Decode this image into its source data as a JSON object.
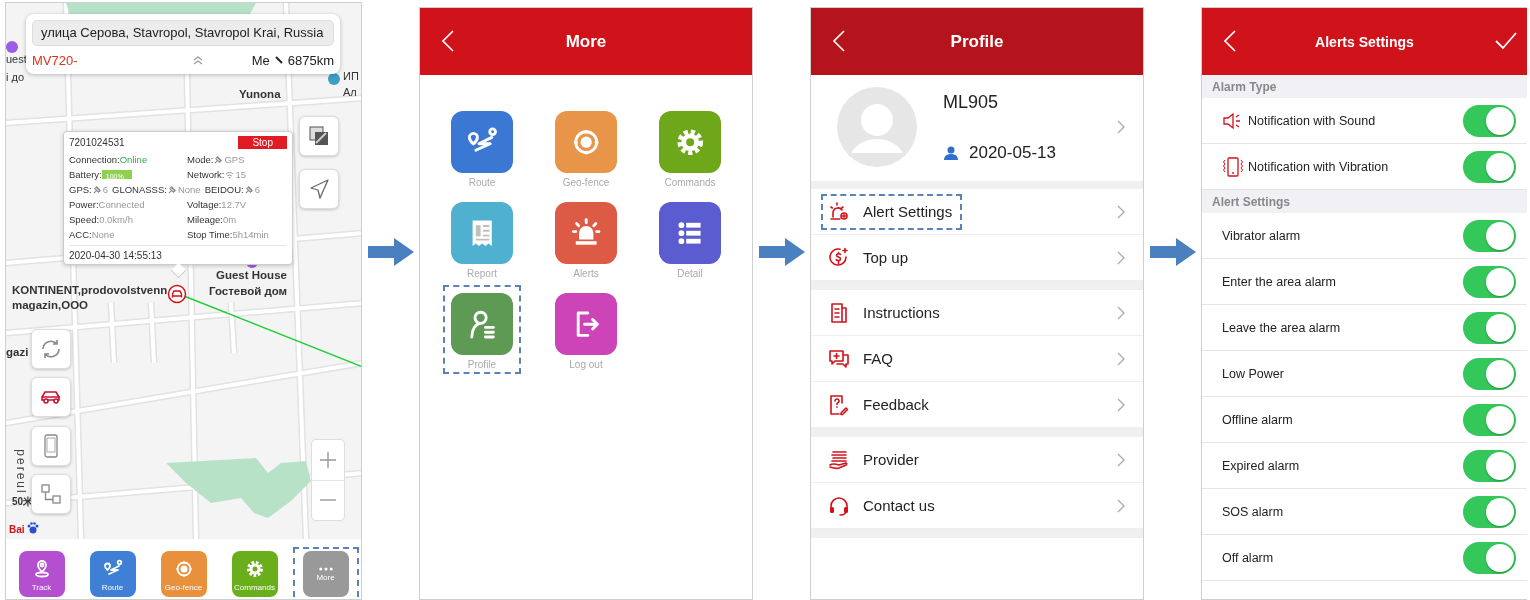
{
  "map_screen": {
    "address": "улица Серова, Stavropol, Stavropol Krai, Russia",
    "device_name": "MV720-",
    "distance_label": "Me",
    "distance": "6875km",
    "map_labels": [
      "uest",
      "i до",
      "ИП",
      "Ал",
      "Yunona",
      "Guest House",
      "Гостевой дом",
      "KONTINENT,prodovolstvenn",
      "magazin,OOO",
      "gazi",
      "pereul",
      "50米",
      "Bai"
    ],
    "popup": {
      "device_id": "7201024531",
      "status": "Stop",
      "time": "2020-04-30 14:55:13",
      "rows": [
        [
          {
            "label": "Connection:",
            "value": "Online",
            "kind": "status"
          },
          {
            "label": "Mode:",
            "value": "GPS",
            "kind": "satellite"
          }
        ],
        [
          {
            "label": "Battery:",
            "value": "100%",
            "kind": "battery",
            "level": 1
          },
          {
            "label": "Network:",
            "value": "15",
            "kind": "wifi"
          }
        ],
        [
          {
            "label": "GPS:",
            "value": "6",
            "kind": "satellite"
          },
          {
            "label": "GLONASSS:",
            "value": "None",
            "kind": "satellite"
          },
          {
            "label": "BEIDOU:",
            "value": "6",
            "kind": "satellite"
          }
        ],
        [
          {
            "label": "Power:",
            "value": "Connected",
            "kind": "text"
          },
          {
            "label": "Voltage:",
            "value": "12.7V",
            "kind": "text"
          }
        ],
        [
          {
            "label": "Speed:",
            "value": "0.0km/h",
            "kind": "text"
          },
          {
            "label": "Mileage:",
            "value": "0m",
            "kind": "text"
          }
        ],
        [
          {
            "label": "ACC:",
            "value": "None",
            "kind": "text"
          },
          {
            "label": "Stop Time:",
            "value": "5h14min",
            "kind": "text"
          }
        ]
      ]
    },
    "tabs": [
      {
        "label": "Track",
        "kind": "track",
        "color": "#b44fd0",
        "highlighted": false
      },
      {
        "label": "Route",
        "kind": "route",
        "color": "#3f7fd6",
        "highlighted": false
      },
      {
        "label": "Geo-fence",
        "kind": "geofence",
        "color": "#e8903c",
        "highlighted": false
      },
      {
        "label": "Commands",
        "kind": "commands",
        "color": "#6aae1c",
        "highlighted": false
      },
      {
        "label": "More",
        "kind": "more",
        "color": "#999999",
        "highlighted": true
      }
    ]
  },
  "more_screen": {
    "title": "More",
    "items": [
      {
        "label": "Route",
        "kind": "route",
        "color": "#3a78d4",
        "highlighted": false
      },
      {
        "label": "Geo-fence",
        "kind": "geofence",
        "color": "#e8954a",
        "highlighted": false
      },
      {
        "label": "Commands",
        "kind": "commands",
        "color": "#6ea81a",
        "highlighted": false
      },
      {
        "label": "Report",
        "kind": "report",
        "color": "#4fb0d0",
        "highlighted": false
      },
      {
        "label": "Alerts",
        "kind": "alerts",
        "color": "#dd5a44",
        "highlighted": false
      },
      {
        "label": "Detail",
        "kind": "detail",
        "color": "#5a5cd0",
        "highlighted": false
      },
      {
        "label": "Profile",
        "kind": "profile",
        "color": "#5f9a54",
        "highlighted": true
      },
      {
        "label": "Log out",
        "kind": "logout",
        "color": "#cc44b8",
        "highlighted": false
      }
    ]
  },
  "profile_screen": {
    "title": "Profile",
    "name": "ML905",
    "date": "2020-05-13",
    "groups": [
      [
        {
          "label": "Alert Settings",
          "kind": "alert",
          "highlighted": true
        },
        {
          "label": "Top up",
          "kind": "topup",
          "highlighted": false
        }
      ],
      [
        {
          "label": "Instructions",
          "kind": "instructions",
          "highlighted": false
        },
        {
          "label": "FAQ",
          "kind": "faq",
          "highlighted": false
        },
        {
          "label": "Feedback",
          "kind": "feedback",
          "highlighted": false
        }
      ],
      [
        {
          "label": "Provider",
          "kind": "provider",
          "highlighted": false
        },
        {
          "label": "Contact us",
          "kind": "contact",
          "highlighted": false
        }
      ]
    ]
  },
  "alerts_screen": {
    "title": "Alerts Settings",
    "sections": [
      {
        "header": "Alarm Type",
        "items": [
          {
            "label": "Notification with Sound",
            "kind": "sound",
            "on": true
          },
          {
            "label": "Notification with Vibration",
            "kind": "vibration",
            "on": true
          }
        ]
      },
      {
        "header": "Alert Settings",
        "items": [
          {
            "label": "Vibrator alarm",
            "kind": "plain",
            "on": true
          },
          {
            "label": "Enter the area alarm",
            "kind": "plain",
            "on": true
          },
          {
            "label": "Leave the area alarm",
            "kind": "plain",
            "on": true
          },
          {
            "label": "Low Power",
            "kind": "plain",
            "on": true
          },
          {
            "label": "Offline alarm",
            "kind": "plain",
            "on": true
          },
          {
            "label": "Expired alarm",
            "kind": "plain",
            "on": true
          },
          {
            "label": "SOS alarm",
            "kind": "plain",
            "on": true
          },
          {
            "label": "Off alarm",
            "kind": "plain",
            "on": true
          }
        ]
      }
    ]
  }
}
